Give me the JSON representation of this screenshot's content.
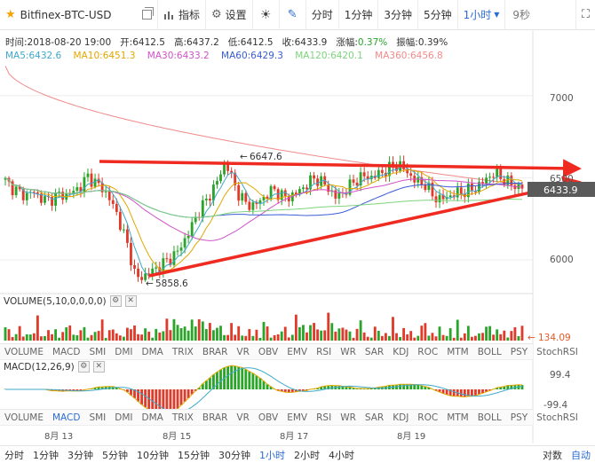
{
  "toolbar": {
    "symbol": "Bitfinex-BTC-USD",
    "indicator_label": "指标",
    "settings_label": "设置",
    "periods": [
      "分时",
      "1分钟",
      "3分钟",
      "5分钟",
      "1小时"
    ],
    "active_period": "1小时",
    "countdown": "9秒"
  },
  "info": {
    "time": "时间:2018-08-20 19:00",
    "open": "开:6412.5",
    "high": "高:6437.2",
    "low": "低:6412.5",
    "close": "收:6433.9",
    "change": "涨幅:",
    "change_val": "0.37%",
    "amplitude": "振幅:0.39%"
  },
  "ma": {
    "ma5": "MA5:6432.6",
    "ma10": "MA10:6451.3",
    "ma30": "MA30:6433.2",
    "ma60": "MA60:6429.3",
    "ma120": "MA120:6420.1",
    "ma360": "MA360:6456.8",
    "colors": {
      "ma5": "#3fa9c9",
      "ma10": "#e0a800",
      "ma30": "#d152c8",
      "ma60": "#3a5bd6",
      "ma120": "#7dd37d",
      "ma360": "#f08a8a"
    }
  },
  "price_axis": {
    "p7000": "7000",
    "p6500": "6500",
    "p6000": "6000",
    "current": "6433.9"
  },
  "annotations": {
    "high": "6647.6",
    "low": "5858.6"
  },
  "volume": {
    "label": "VOLUME(5,10,0,0,0,0)",
    "current": "134.09"
  },
  "macd": {
    "label": "MACD(12,26,9)",
    "top": "99.4",
    "bottom": "-99.4"
  },
  "indicator_tabs": [
    "VOLUME",
    "MACD",
    "SMI",
    "DMI",
    "DMA",
    "TRIX",
    "BRAR",
    "VR",
    "OBV",
    "EMV",
    "RSI",
    "WR",
    "SAR",
    "KDJ",
    "ROC",
    "MTM",
    "BOLL",
    "PSY",
    "StochRSI"
  ],
  "dates": [
    "8月 13",
    "8月 15",
    "8月 17",
    "8月 19"
  ],
  "bottom_periods": [
    "分时",
    "1分钟",
    "3分钟",
    "5分钟",
    "10分钟",
    "15分钟",
    "30分钟",
    "1小时",
    "2小时",
    "4小时"
  ],
  "bottom_active": "1小时",
  "scale_modes": [
    "对数",
    "自动"
  ],
  "scale_active": "自动",
  "colors": {
    "up": "#2aa52a",
    "down": "#e03a2a",
    "accent": "#2a6cd6",
    "trend": "#ef2a20"
  },
  "chart_data": {
    "type": "candlestick",
    "symbol": "Bitfinex-BTC-USD",
    "interval": "1小时",
    "ylim": [
      5800,
      7150
    ],
    "y_ticks": [
      6000,
      6500,
      7000
    ],
    "high_mark": 6647.6,
    "low_mark": 5858.6,
    "last_close": 6433.9,
    "close_path": [
      6480,
      6440,
      6410,
      6390,
      6420,
      6380,
      6360,
      6380,
      6400,
      6390,
      6420,
      6450,
      6510,
      6470,
      6440,
      6380,
      6300,
      6180,
      6050,
      5880,
      5900,
      5920,
      5950,
      5980,
      6010,
      6050,
      6120,
      6200,
      6290,
      6350,
      6420,
      6500,
      6600,
      6480,
      6390,
      6340,
      6330,
      6360,
      6400,
      6430,
      6390,
      6380,
      6400,
      6430,
      6470,
      6500,
      6470,
      6430,
      6380,
      6410,
      6450,
      6490,
      6510,
      6500,
      6520,
      6540,
      6560,
      6580,
      6550,
      6500,
      6470,
      6460,
      6390,
      6370,
      6380,
      6400,
      6410,
      6420,
      6430,
      6460,
      6500,
      6530,
      6500,
      6470,
      6450,
      6433.9
    ]
  }
}
